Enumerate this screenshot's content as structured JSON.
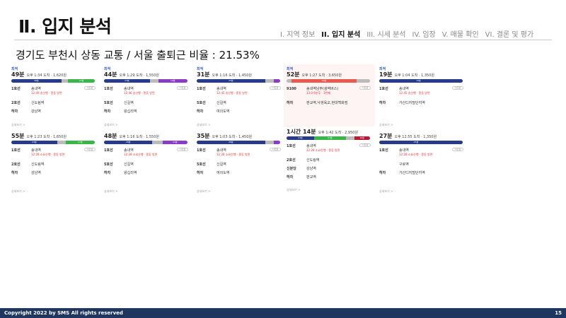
{
  "slide": {
    "title": "Ⅱ. 입지 분석",
    "subtitle": "경기도 부천시 상동 교통 / 서울 출퇴근 비율 : 21.53%",
    "nav": [
      "I. 지역 정보",
      "II. 입지 분석",
      "III. 시세 분석",
      "IV. 임장",
      "V. 매물 확인",
      "VI. 결론 및 평가"
    ],
    "active_nav_index": 1
  },
  "colors": {
    "line1": "#263c8a",
    "line2": "#3ab54a",
    "line5": "#8a3cc4",
    "sinbundang": "#b81c35",
    "bus": "#e85a4f",
    "footer": "#1f3660"
  },
  "cards": [
    {
      "label": "최적",
      "dur": "49분",
      "meta": "오후 1:34 도착 · 1,620원",
      "bar": [
        [
          "48분",
          "#263c8a",
          0.6
        ],
        [
          "",
          "#bbb",
          0.08
        ],
        [
          "27분",
          "#3ab54a",
          0.32
        ]
      ],
      "rows": [
        [
          "1호선",
          "송내역",
          "12:49 송산행 · 종동 방면"
        ],
        [
          "2호선",
          "신도림역",
          ""
        ],
        [
          "하차",
          "강남역",
          ""
        ]
      ],
      "more": "상세보기 >"
    },
    {
      "label": "최적",
      "dur": "44분",
      "meta": "오후 1:29 도착 · 1,550원",
      "bar": [
        [
          "23분",
          "#263c8a",
          0.55
        ],
        [
          "",
          "#bbb",
          0.1
        ],
        [
          "19분",
          "#8a3cc4",
          0.35
        ]
      ],
      "rows": [
        [
          "1호선",
          "송내역",
          "12:46 송산행 · 종동 방면"
        ],
        [
          "5호선",
          "신길역",
          ""
        ],
        [
          "하차",
          "왕십리역",
          ""
        ]
      ],
      "more": "상세보기 >"
    },
    {
      "label": "최적",
      "dur": "31분",
      "meta": "오후 1:16 도착 · 1,450원",
      "bar": [
        [
          "23분",
          "#263c8a",
          0.82
        ],
        [
          "",
          "#bbb",
          0.1
        ],
        [
          "",
          "#8a3cc4",
          0.08
        ]
      ],
      "rows": [
        [
          "1호선",
          "송내역",
          "12:45 송산행 · 종동 방면"
        ],
        [
          "5호선",
          "신길역",
          ""
        ],
        [
          "하차",
          "여의도역",
          ""
        ]
      ],
      "more": "상세보기 >"
    },
    {
      "label": "최적",
      "dur": "52분",
      "meta": "오후 1:27 도착 · 3,650원",
      "sel": true,
      "bar": [
        [
          "",
          "#bbb",
          0.06
        ],
        [
          "40분",
          "#e85a4f",
          0.78
        ],
        [
          "",
          "#bbb",
          0.16
        ]
      ],
      "rows": [
        [
          "9100",
          "송내역남부(광역버스)",
          "13:0 6분후 · 3번째"
        ],
        [
          "하차",
          "판교역,낙생육교,현대백화점",
          ""
        ]
      ],
      "more": "상세보기 >"
    },
    {
      "label": "최적",
      "dur": "19분",
      "meta": "오후 1:04 도착 · 1,350원",
      "bar": [
        [
          "19분",
          "#263c8a",
          0.94
        ],
        [
          "",
          "#263c8a",
          0.06
        ]
      ],
      "rows": [
        [
          "1호선",
          "송내역",
          "12:45 송산행 · 종동 방면"
        ],
        [
          "하차",
          "가산디지털단지역",
          ""
        ]
      ],
      "more": "상세보기 >"
    },
    {
      "label": "",
      "dur": "55분",
      "meta": "오후 1:23 도착 · 1,650원",
      "bar": [
        [
          "23분",
          "#263c8a",
          0.55
        ],
        [
          "",
          "#bbb",
          0.1
        ],
        [
          "27분",
          "#3ab54a",
          0.35
        ]
      ],
      "rows": [
        [
          "1호선",
          "송내역",
          "12:28 소요산행 · 종동 방면"
        ],
        [
          "2호선",
          "신도림역",
          ""
        ],
        [
          "하차",
          "강남역",
          ""
        ]
      ],
      "more": "상세보기 >"
    },
    {
      "label": "",
      "dur": "48분",
      "meta": "오후 1:16 도착 · 1,550원",
      "bar": [
        [
          "28분",
          "#263c8a",
          0.58
        ],
        [
          "",
          "#bbb",
          0.12
        ],
        [
          "13분",
          "#8a3cc4",
          0.3
        ]
      ],
      "rows": [
        [
          "1호선",
          "송내역",
          "12:28 소요산행 · 종동 방면"
        ],
        [
          "5호선",
          "신길역",
          ""
        ],
        [
          "하차",
          "왕십리역",
          ""
        ]
      ],
      "more": "상세보기 >"
    },
    {
      "label": "",
      "dur": "35분",
      "meta": "오후 1:03 도착 · 1,450원",
      "bar": [
        [
          "28분",
          "#263c8a",
          0.82
        ],
        [
          "",
          "#bbb",
          0.1
        ],
        [
          "",
          "#8a3cc4",
          0.08
        ]
      ],
      "rows": [
        [
          "1호선",
          "송내역",
          "12:28 소요산행 · 종동 방면"
        ],
        [
          "5호선",
          "신길역",
          ""
        ],
        [
          "하차",
          "여의도역",
          ""
        ]
      ],
      "more": "상세보기 >"
    },
    {
      "label": "",
      "dur": "1시간 14분",
      "meta": "오후 1:42 도착 · 2,950원",
      "bar": [
        [
          "23분",
          "#263c8a",
          0.33
        ],
        [
          "27분",
          "#3ab54a",
          0.38
        ],
        [
          "",
          "#bbb",
          0.1
        ],
        [
          "16분",
          "#b81c35",
          0.19
        ]
      ],
      "rows": [
        [
          "1호선",
          "송내역",
          "12:28 소요산행 · 종동 방면"
        ],
        [
          "2호선",
          "신도림역",
          ""
        ],
        [
          "신분당",
          "강남역",
          ""
        ],
        [
          "하차",
          "판교역",
          ""
        ]
      ],
      "more": "상세보기 >"
    },
    {
      "label": "",
      "dur": "27분",
      "meta": "오후 12:55 도착 · 1,350원",
      "bar": [
        [
          "27분",
          "#263c8a",
          0.88
        ],
        [
          "",
          "#263c8a",
          0.12
        ]
      ],
      "rows": [
        [
          "1호선",
          "송내역",
          "12:28 소요산행 · 종동 방면"
        ],
        [
          "",
          "구로역",
          ""
        ],
        [
          "하차",
          "가산디지털단지역",
          ""
        ]
      ],
      "more": "상세보기 >"
    }
  ],
  "footer": {
    "copyright": "Copyright 2022 by SMS All rights reserved",
    "page": "15"
  }
}
